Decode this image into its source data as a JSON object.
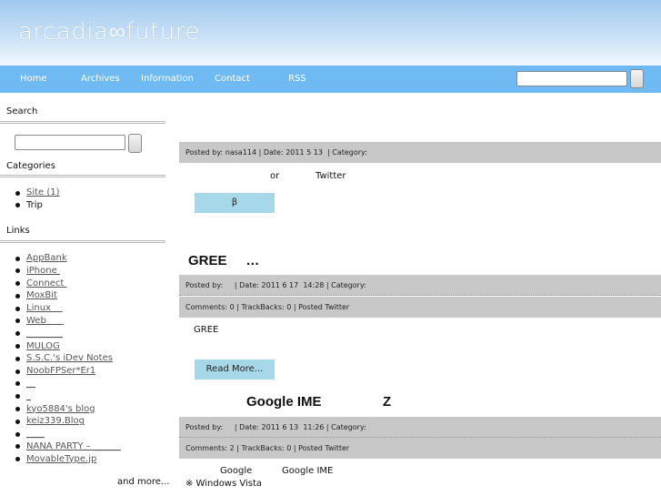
{
  "site": {
    "logo": "arcadia∞future"
  },
  "nav": {
    "items": [
      "Home",
      "Archives",
      "Information",
      "Contact",
      "RSS"
    ],
    "search_value": "",
    "search_button": ""
  },
  "sidebar": {
    "search_title": "Search",
    "search_value": "",
    "search_button": "",
    "categories_title": "Categories",
    "categories": [
      {
        "label": "Site (1)",
        "link": true
      },
      {
        "label": "Trip",
        "link": false
      }
    ],
    "links_title": "Links",
    "links": [
      "AppBank",
      "iPhone ",
      "Connect ",
      "MoxBit",
      "Linux    ",
      "Web      ",
      "________",
      "MULOG",
      "S.S.C.'s iDev Notes",
      "NoobFPSer*Er1",
      "__",
      "_",
      "kyo5884's blog",
      "keiz339.Blog",
      "____",
      "NANA PARTY – ______",
      "MovableType.jp"
    ],
    "more": "and more..."
  },
  "posts": [
    {
      "meta": "Posted by: nasa114 | Date: 2011 5 13  | Category:",
      "body_left": "or",
      "body_right": "Twitter",
      "button": "β"
    },
    {
      "title": "GREE     …",
      "meta": "Posted by:     | Date: 2011 6 17  14:28 | Category:",
      "comments": "Comments: 0 | TrackBacks: 0 | Posted Twitter",
      "body": "GREE",
      "button": "Read More..."
    },
    {
      "title_left": "Google IME",
      "title_right": "Z",
      "meta": "Posted by:     | Date: 2011 6 13  11:26 | Category:",
      "comments": "Comments: 2 | TrackBacks: 0 | Posted Twitter",
      "body_left": "Google",
      "body_right": "Google IME",
      "body_line2": "※ Windows Vista"
    }
  ]
}
